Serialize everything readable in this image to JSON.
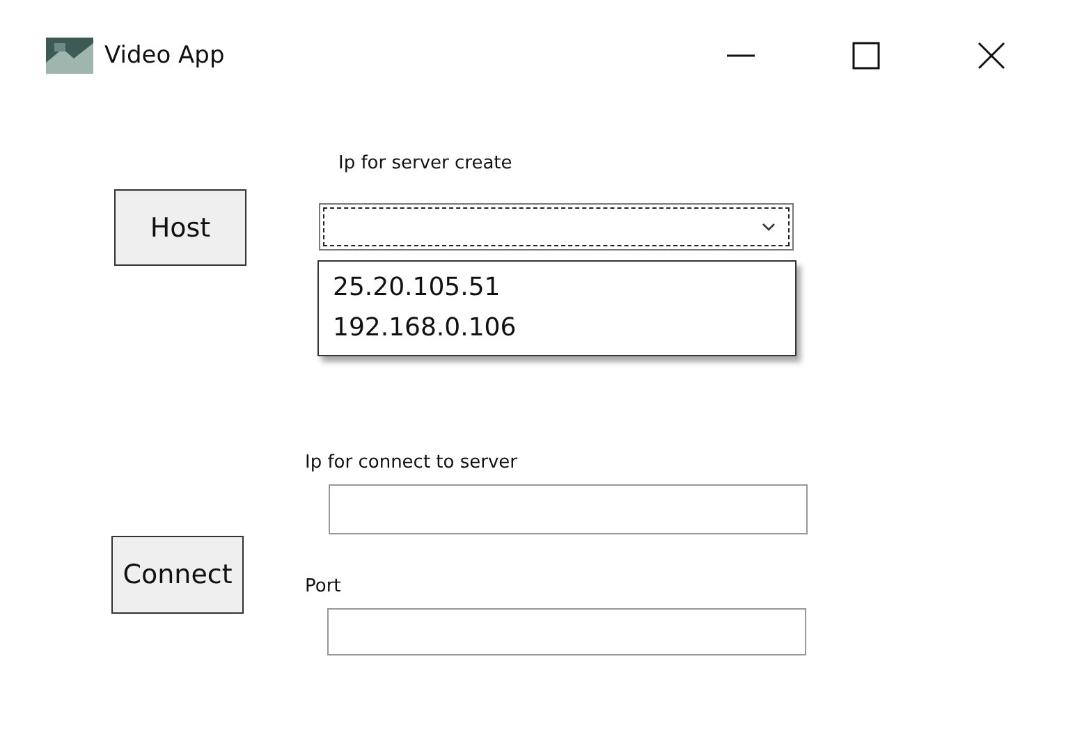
{
  "window": {
    "title": "Video App"
  },
  "host": {
    "button": "Host",
    "label": "Ip for server create",
    "combo": {
      "focused": true,
      "open": true,
      "options": [
        "25.20.105.51",
        "192.168.0.106"
      ]
    }
  },
  "connect": {
    "button": "Connect",
    "ip_label": "Ip for connect to server",
    "port_label": "Port"
  }
}
